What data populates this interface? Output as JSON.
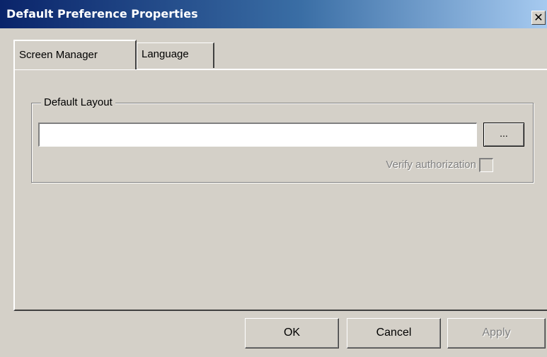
{
  "window": {
    "title": "Default Preference Properties",
    "close_glyph": "✕"
  },
  "tabs": [
    {
      "label": "Screen Manager",
      "active": true
    },
    {
      "label": "Language",
      "active": false
    }
  ],
  "group": {
    "legend": "Default Layout",
    "layout_value": "",
    "layout_placeholder": "",
    "browse_label": "...",
    "verify_label": "Verify authorization",
    "verify_checked": false,
    "verify_enabled": false
  },
  "buttons": {
    "ok_label": "OK",
    "cancel_label": "Cancel",
    "apply_label": "Apply",
    "apply_enabled": false
  },
  "colors": {
    "title_gradient_start": "#0a246a",
    "title_gradient_end": "#a6caf0",
    "dialog_face": "#d4d0c8",
    "disabled_text": "#808080"
  }
}
